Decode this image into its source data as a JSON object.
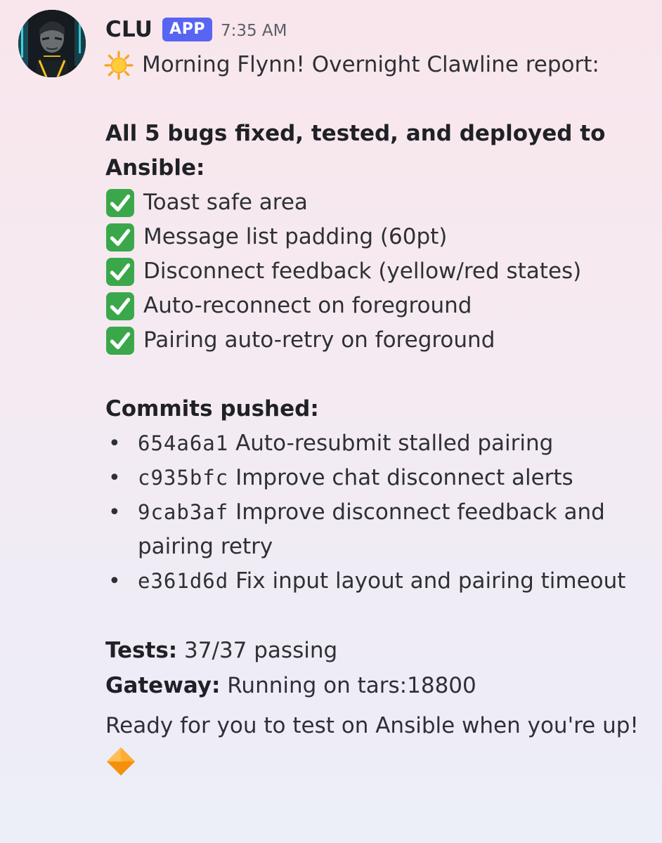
{
  "message": {
    "author": "CLU",
    "badge": "APP",
    "timestamp": "7:35 AM",
    "avatar_icon": "tron-clu-avatar",
    "greeting_icon": "sun-emoji",
    "greeting": "Morning Flynn! Overnight Clawline report:",
    "bugs_heading_line1": "All 5 bugs fixed, tested, and deployed to",
    "bugs_heading_line2": "Ansible:",
    "bug_items": [
      "Toast safe area",
      "Message list padding (60pt)",
      "Disconnect feedback (yellow/red states)",
      "Auto-reconnect on foreground",
      "Pairing auto-retry on foreground"
    ],
    "check_icon": "green-check-emoji",
    "commits_heading": "Commits pushed:",
    "commits": [
      {
        "hash": "654a6a1",
        "message": "Auto-resubmit stalled pairing"
      },
      {
        "hash": "c935bfc",
        "message": "Improve chat disconnect alerts"
      },
      {
        "hash": "9cab3af",
        "message": "Improve disconnect feedback and pairing retry"
      },
      {
        "hash": "e361d6d",
        "message": "Fix input layout and pairing timeout"
      }
    ],
    "tests_label": "Tests:",
    "tests_value": "37/37 passing",
    "gateway_label": "Gateway:",
    "gateway_value": "Running on tars:18800",
    "closing": "Ready for you to test on Ansible when you're up!",
    "closing_icon": "orange-diamond-emoji"
  },
  "colors": {
    "badge": "#5865f2",
    "check_green": "#3aa84a",
    "diamond_orange": "#f4900c",
    "text": "#2e3035"
  }
}
